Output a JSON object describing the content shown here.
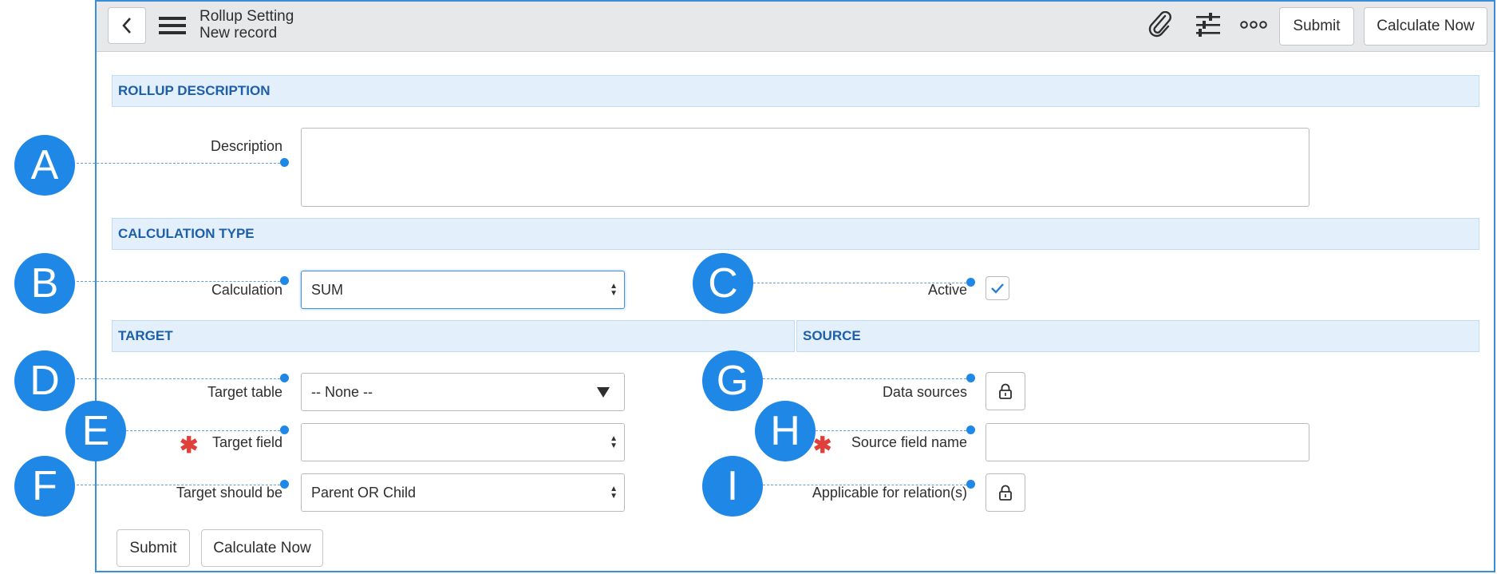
{
  "header": {
    "title": "Rollup Setting",
    "subtitle": "New record",
    "submit_label": "Submit",
    "calculate_label": "Calculate Now"
  },
  "sections": {
    "rollup_description": "ROLLUP DESCRIPTION",
    "calculation_type": "CALCULATION TYPE",
    "target": "TARGET",
    "source": "SOURCE"
  },
  "fields": {
    "description": {
      "label": "Description",
      "value": ""
    },
    "calculation": {
      "label": "Calculation",
      "value": "SUM"
    },
    "active": {
      "label": "Active",
      "checked": true
    },
    "target_table": {
      "label": "Target table",
      "value": "-- None --"
    },
    "target_field": {
      "label": "Target field",
      "value": "",
      "required": true
    },
    "target_should_be": {
      "label": "Target should be",
      "value": "Parent OR Child"
    },
    "data_sources": {
      "label": "Data sources"
    },
    "source_field_name": {
      "label": "Source field name",
      "value": "",
      "required": true
    },
    "applicable_relations": {
      "label": "Applicable for relation(s)"
    }
  },
  "footer": {
    "submit_label": "Submit",
    "calculate_label": "Calculate Now"
  },
  "markers": [
    "A",
    "B",
    "C",
    "D",
    "E",
    "F",
    "G",
    "H",
    "I"
  ],
  "colors": {
    "accent": "#1f87e5",
    "section_bg": "#e3f0fc",
    "section_text": "#1d5fa8",
    "required": "#e0403a"
  }
}
